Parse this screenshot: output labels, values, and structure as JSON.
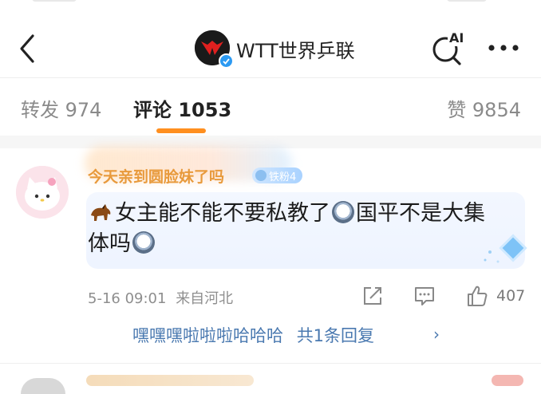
{
  "header": {
    "account_name": "WTT世界乒联",
    "ai_label": "AI"
  },
  "tabs": [
    {
      "label": "转发 974"
    },
    {
      "label": "评论 1053"
    },
    {
      "label": "赞 9854"
    }
  ],
  "comment": {
    "username": "今天亲到圆脸妹了吗",
    "fan_badge": "铁粉4",
    "text": "女主能不能不要私教了国平不是大集体吗",
    "text_part1": "女主能不能不要私教了",
    "text_part2": "国平不是大集体吗",
    "timestamp": "5-16 09:01",
    "location": "来自河北",
    "like_count": "407",
    "reply_preview": "嘿嘿嘿啦啦啦哈哈哈",
    "reply_count": "共1条回复",
    "reply_chevron": "›"
  },
  "colors": {
    "accent": "#ff8f1f",
    "username": "#e89a3c",
    "link": "#4a79b0",
    "verified": "#2c9af2"
  }
}
